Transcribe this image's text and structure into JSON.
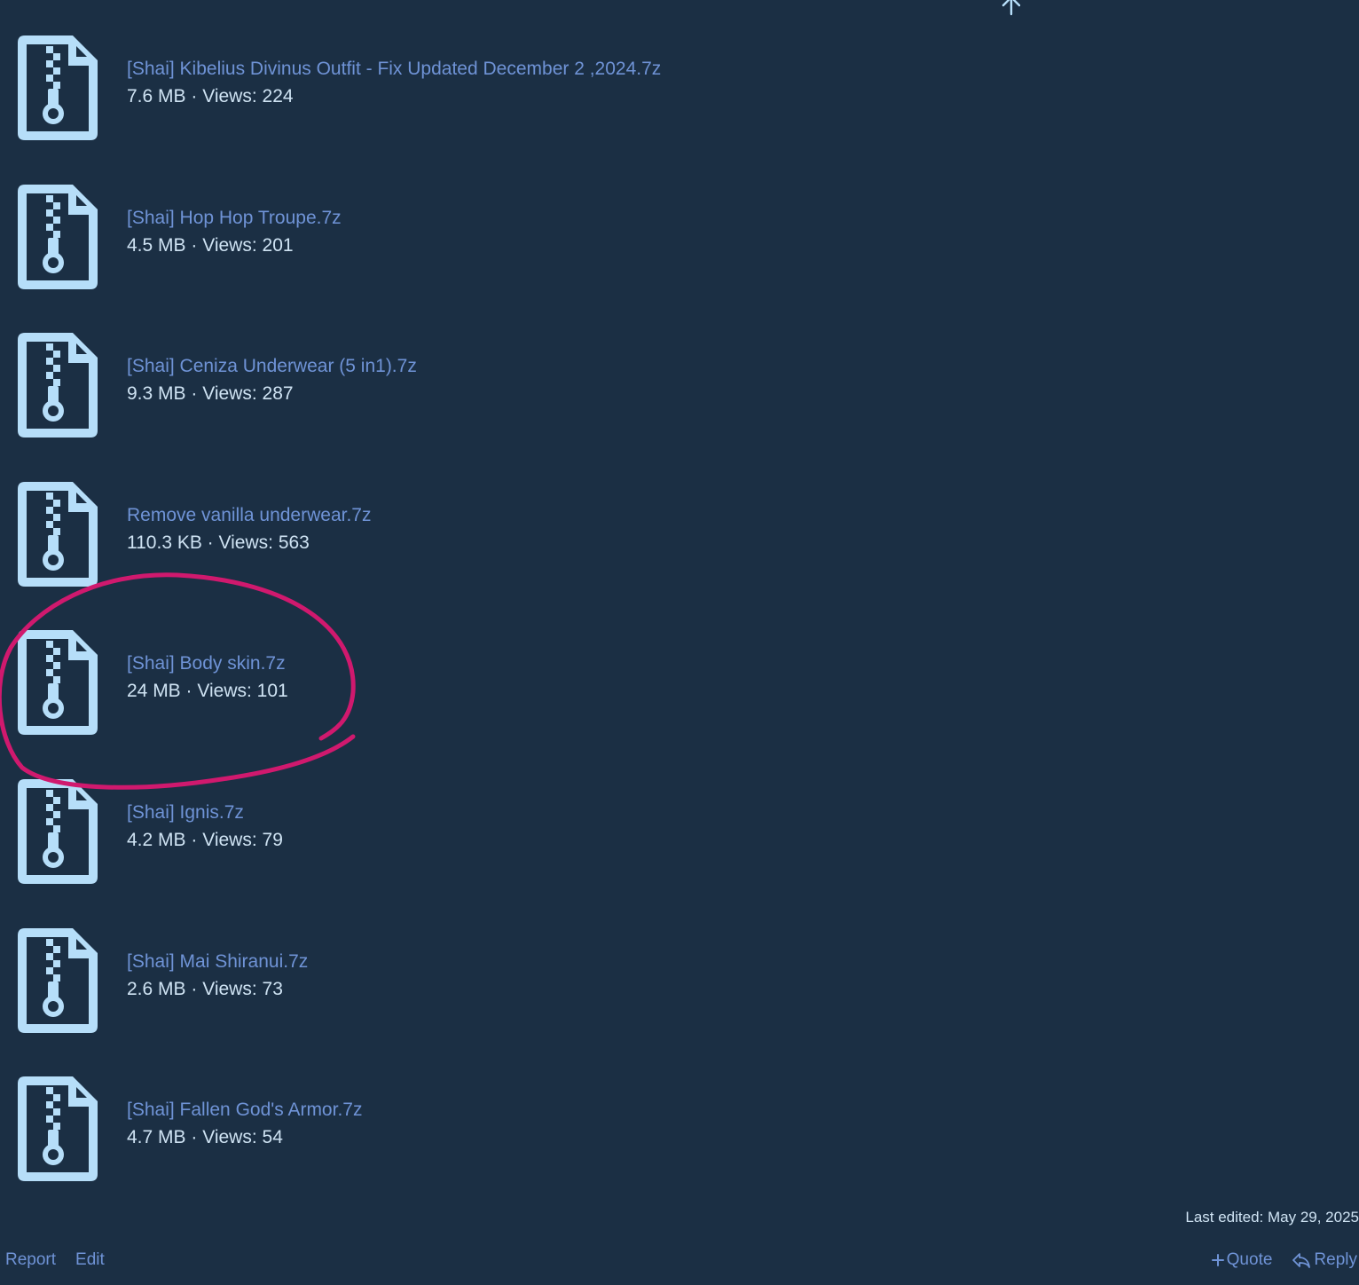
{
  "colors": {
    "background": "#1b2f44",
    "icon": "#b6def9",
    "link": "#6f93d6",
    "meta_text": "#cfe3f3",
    "annotation": "#d0196e"
  },
  "attachments": [
    {
      "name": "[Shai] Kibelius Divinus Outfit - Fix Updated December 2 ,2024.7z",
      "size": "7.6 MB",
      "views_text": "Views: 224",
      "icon": "file-zip-icon"
    },
    {
      "name": "[Shai] Hop Hop Troupe.7z",
      "size": "4.5 MB",
      "views_text": "Views: 201",
      "icon": "file-zip-icon"
    },
    {
      "name": "[Shai] Ceniza Underwear (5 in1).7z",
      "size": "9.3 MB",
      "views_text": "Views: 287",
      "icon": "file-zip-icon"
    },
    {
      "name": "Remove vanilla underwear.7z",
      "size": "110.3 KB",
      "views_text": "Views: 563",
      "icon": "file-zip-icon"
    },
    {
      "name": "[Shai] Body skin.7z",
      "size": "24 MB",
      "views_text": "Views: 101",
      "icon": "file-zip-icon",
      "highlighted": true
    },
    {
      "name": "[Shai] Ignis.7z",
      "size": "4.2 MB",
      "views_text": "Views: 79",
      "icon": "file-zip-icon"
    },
    {
      "name": "[Shai] Mai Shiranui.7z",
      "size": "2.6 MB",
      "views_text": "Views: 73",
      "icon": "file-zip-icon"
    },
    {
      "name": "[Shai] Fallen God's Armor.7z",
      "size": "4.7 MB",
      "views_text": "Views: 54",
      "icon": "file-zip-icon"
    }
  ],
  "separator": " · ",
  "post": {
    "last_edited": "Last edited: May 29, 2025"
  },
  "actions": {
    "report": "Report",
    "edit": "Edit",
    "quote": "Quote",
    "reply": "Reply"
  },
  "icons": {
    "scroll_top": "arrow-up-icon",
    "quote": "plus-icon",
    "reply": "reply-arrow-icon"
  }
}
